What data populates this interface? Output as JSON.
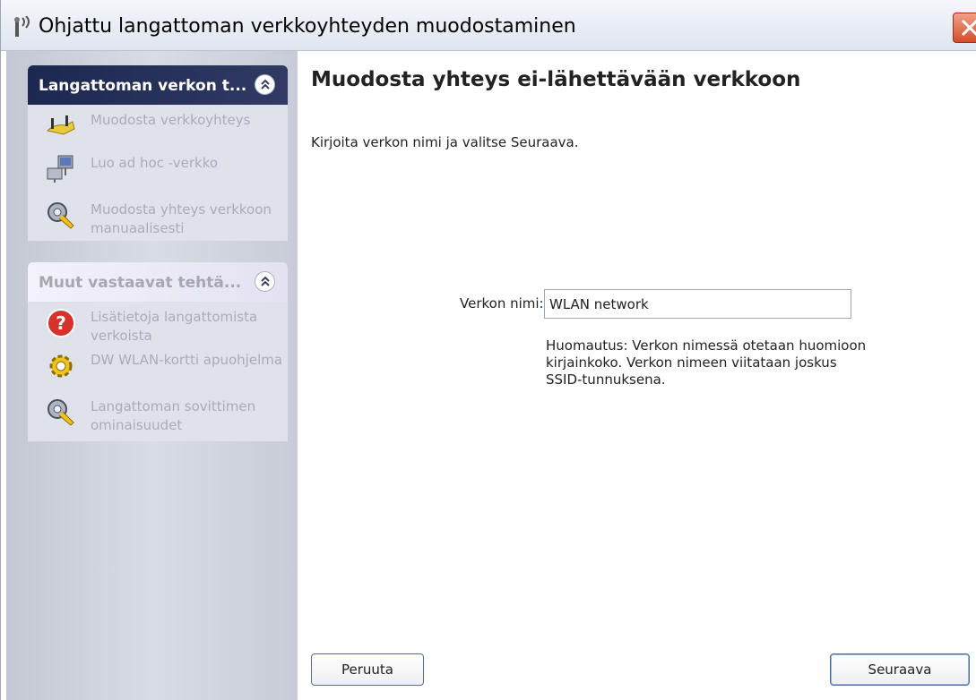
{
  "window": {
    "title": "Ohjattu langattoman verkkoyhteyden muodostaminen"
  },
  "icons": {
    "title": "wireless-antenna-icon",
    "close": "close-icon",
    "collapse": "chevron-double-up-icon",
    "task_connect": "wireless-connection-icon",
    "task_adhoc": "ad-hoc-network-icon",
    "task_manual": "wrench-gear-icon",
    "task_help": "help-icon",
    "task_dw": "gear-icon",
    "task_adapter": "wrench-gear-icon"
  },
  "sidebar": {
    "panels": [
      {
        "title": "Langattoman verkon t...",
        "items": [
          {
            "label": "Muodosta verkkoyhteys"
          },
          {
            "label": "Luo ad hoc -verkko"
          },
          {
            "label": "Muodosta yhteys verkkoon manuaalisesti"
          }
        ]
      },
      {
        "title": "Muut vastaavat tehtä...",
        "items": [
          {
            "label": "Lisätietoja langattomista verkoista"
          },
          {
            "label": "DW WLAN-kortti apuohjelma"
          },
          {
            "label": "Langattoman sovittimen ominaisuudet"
          }
        ]
      }
    ]
  },
  "main": {
    "title": "Muodosta yhteys ei-lähettävään verkkoon",
    "intro": "Kirjoita verkon nimi ja valitse Seuraava.",
    "network_name_label": "Verkon nimi:",
    "network_name_value": "WLAN network",
    "note": "Huomautus: Verkon nimessä otetaan huomioon kirjainkoko. Verkon nimeen viitataan joskus SSID-tunnuksena."
  },
  "buttons": {
    "cancel": "Peruuta",
    "next": "Seuraava"
  },
  "colors": {
    "sidebar_header": "#1d2850",
    "close_button": "#d24d2b",
    "muted_text": "#a9acb8"
  }
}
